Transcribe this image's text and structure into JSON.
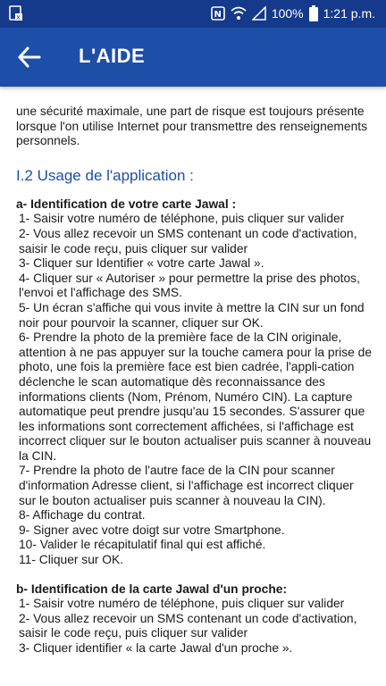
{
  "status_bar": {
    "time": "1:21 p.m.",
    "battery": "100%",
    "icons": [
      "app-notification-icon",
      "nfc-icon",
      "wifi-icon",
      "signal-icon",
      "battery-icon"
    ]
  },
  "app_bar": {
    "title": "L'AIDE",
    "back_icon": "arrow-back-icon"
  },
  "content": {
    "intro_text": "une sécurité maximale, une part de risque est toujours présente lorsque l'on utilise Internet pour transmettre des renseignements personnels.",
    "section_title": "I.2 Usage de l'application :",
    "section_a": {
      "title": "a- Identification de votre carte Jawal :",
      "steps": [
        "1- Saisir votre numéro de téléphone, puis cliquer sur valider",
        "2- Vous allez recevoir un SMS contenant un code d'activation, saisir le code reçu, puis cliquer sur valider",
        "3- Cliquer sur Identifier « votre carte Jawal ».",
        "4- Cliquer sur « Autoriser » pour permettre la prise des photos, l'envoi et l'affichage des SMS.",
        "5- Un écran s'affiche qui vous invite à mettre la CIN sur un fond noir pour pourvoir la scanner, cliquer sur OK.",
        "6- Prendre la photo de la première face de la CIN originale, attention à ne pas appuyer sur la touche camera pour la prise de photo, une fois la première face est bien cadrée, l'appli-cation déclenche le scan automatique dès reconnaissance des informations clients (Nom, Prénom, Numéro CIN). La capture automatique peut prendre jusqu'au 15 secondes. S'assurer que les informations sont correctement affichées, si l'affichage est incorrect cliquer sur le bouton actualiser puis scanner à nouveau la CIN.",
        "7- Prendre la photo de l'autre face de la CIN pour scanner d'information Adresse client, si l'affichage est incorrect cliquer sur le bouton actualiser puis scanner à nouveau la CIN).",
        "8- Affichage du contrat.",
        "9- Signer avec votre doigt sur votre Smartphone.",
        "10- Valider le récapitulatif final qui est affiché.",
        "11- Cliquer sur OK."
      ]
    },
    "section_b": {
      "title": "b- Identification de la carte Jawal d'un proche:",
      "steps": [
        "1- Saisir votre numéro de téléphone, puis cliquer sur valider",
        "2- Vous allez recevoir un SMS contenant un code d'activation, saisir le code reçu, puis cliquer sur valider",
        "3- Cliquer identifier « la carte Jawal d'un proche »."
      ]
    }
  }
}
